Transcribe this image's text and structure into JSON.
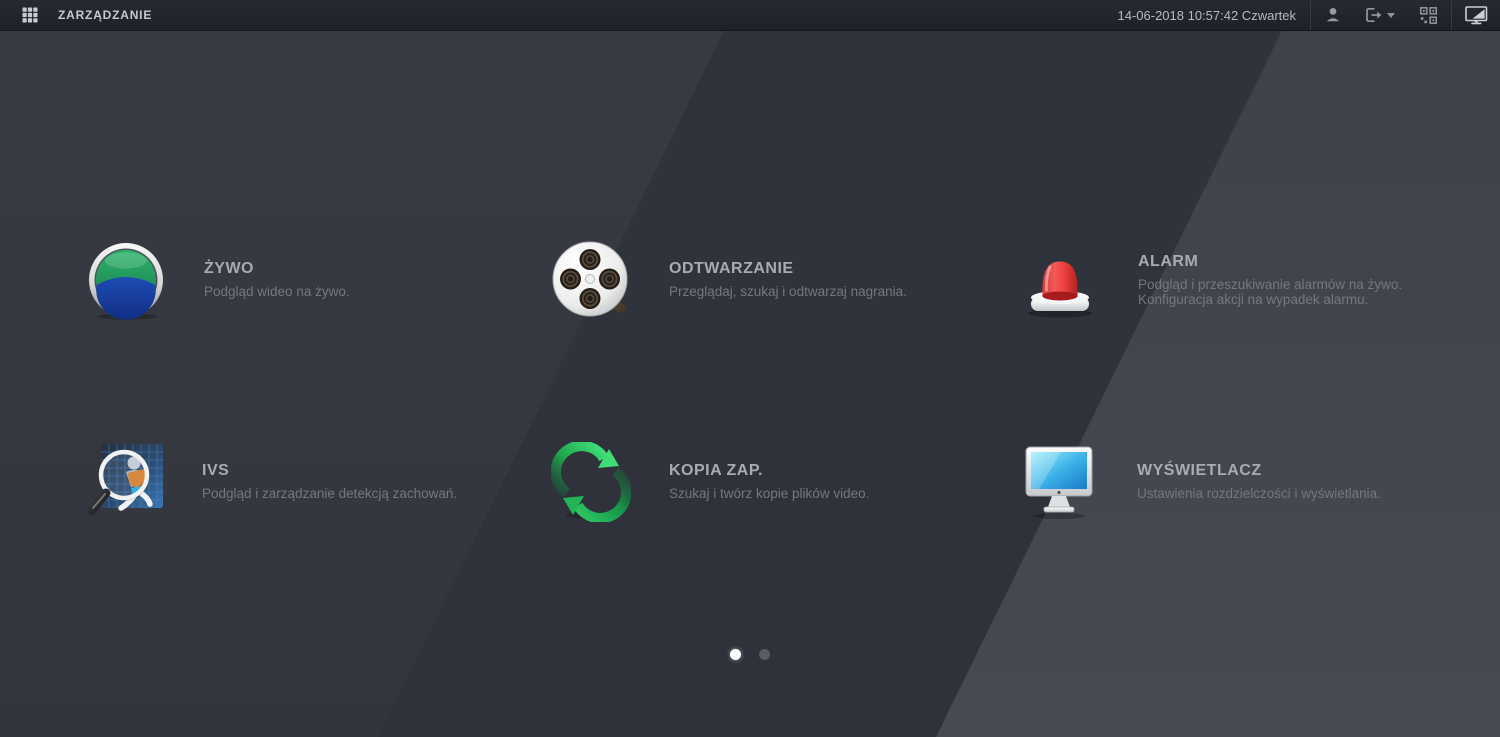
{
  "topbar": {
    "title": "ZARZĄDZANIE",
    "datetime": "14-06-2018 10:57:42 Czwartek",
    "icons": {
      "apps_grid": "grid-3x3",
      "user": "person-silhouette",
      "logout": "door-arrow-out",
      "logout_caret": "caret-down",
      "qr": "qr-code",
      "display_mode": "monitor-diagonal-fill"
    }
  },
  "menu": {
    "items": [
      {
        "id": "zywo",
        "title": "ŻYWO",
        "desc": "Podgląd wideo na żywo.",
        "icon": "live-lens-green-blue"
      },
      {
        "id": "odtwarzanie",
        "title": "ODTWARZANIE",
        "desc": "Przeglądaj, szukaj i odtwarzaj nagrania.",
        "icon": "film-reel"
      },
      {
        "id": "alarm",
        "title": "ALARM",
        "desc": "Podgląd i przeszukiwanie alarmów na żywo.",
        "desc2": "Konfiguracja akcji na wypadek alarmu.",
        "icon": "red-siren"
      },
      {
        "id": "ivs",
        "title": "IVS",
        "desc": "Podgląd i zarządzanie detekcją zachowań.",
        "icon": "magnifier-running-person"
      },
      {
        "id": "kopia_zap",
        "title": "KOPIA ZAP.",
        "desc": "Szukaj i twórz kopie plików video.",
        "icon": "green-sync-arrows"
      },
      {
        "id": "wyswietlacz",
        "title": "WYŚWIETLACZ",
        "desc": "Ustawienia rozdzielczości i wyświetlania.",
        "icon": "cyan-monitor"
      }
    ]
  },
  "pagination": {
    "pages": 2,
    "active_page": 1
  },
  "colors": {
    "topbar_bg": "#23262b",
    "bg_left": "#383b43",
    "bg_band": "#2f3139",
    "bg_right": "#42454e",
    "title_text": "#a7acb3",
    "desc_text": "#73787f",
    "dot_active": "#ffffff",
    "dot_inactive": "#595c63",
    "accent_green": "#2eb26c",
    "accent_blue": "#1c4cb4",
    "accent_red": "#e04444",
    "accent_cyan": "#3fb4e8"
  }
}
